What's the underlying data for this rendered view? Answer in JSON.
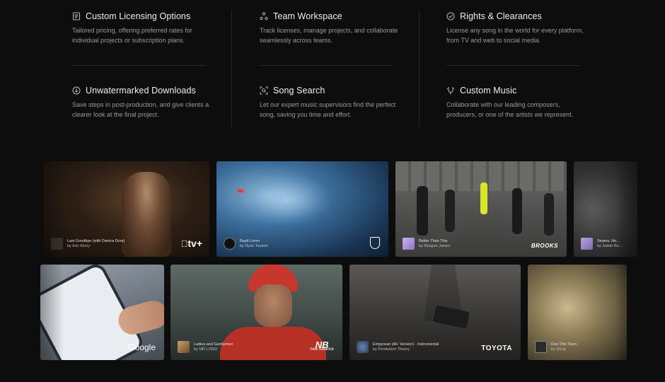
{
  "features": [
    {
      "icon": "document-list-icon",
      "title": "Custom Licensing Options",
      "desc": "Tailored pricing, offering preferred rates for individual projects or subscription plans."
    },
    {
      "icon": "team-nodes-icon",
      "title": "Team Workspace",
      "desc": "Track licenses, manage projects, and collaborate seamlessly across teams."
    },
    {
      "icon": "check-circle-icon",
      "title": "Rights & Clearances",
      "desc": "License any song in the world for every platform, from TV and web to social media."
    },
    {
      "icon": "download-circle-icon",
      "title": "Unwatermarked Downloads",
      "desc": "Save steps in post-production, and give clients a clearer look at the final project."
    },
    {
      "icon": "scan-search-icon",
      "title": "Song Search",
      "desc": "Let our expert music supervisors find the perfect song, saving you time and effort."
    },
    {
      "icon": "tuning-fork-icon",
      "title": "Custom Music",
      "desc": "Collaborate with our leading composers, producers, or one of the artists we represent."
    }
  ],
  "carousel": {
    "row1": [
      {
        "song": "Last Goodbye (with Danica Dora)",
        "artist": "by Eric Kinny",
        "brand": "tv+",
        "brand_name": "apple-tv-plus-logo"
      },
      {
        "song": "Baytt Loren",
        "artist": "by Ryan Taubert",
        "brand": "",
        "brand_name": "lamborghini-logo"
      },
      {
        "song": "Better Than This",
        "artist": "by Reagan James",
        "brand": "BROOKS",
        "brand_name": "brooks-logo"
      },
      {
        "song": "Seams, No…",
        "artist": "by Judah Ro…",
        "brand": "",
        "brand_name": "none"
      }
    ],
    "row2": [
      {
        "song": "",
        "artist": "",
        "brand": "Google",
        "brand_name": "google-logo"
      },
      {
        "song": "Ladies and Gentlemen",
        "artist": "by MR.LONO",
        "brand": "new balance",
        "brand_name": "new-balance-logo"
      },
      {
        "song": "Empyrean (Alt. Version) - Instrumental",
        "artist": "by Pendulium Theory",
        "brand": "TOYOTA",
        "brand_name": "toyota-logo"
      },
      {
        "song": "Run This Town",
        "artist": "by Deraj",
        "brand": "",
        "brand_name": "none"
      }
    ]
  }
}
